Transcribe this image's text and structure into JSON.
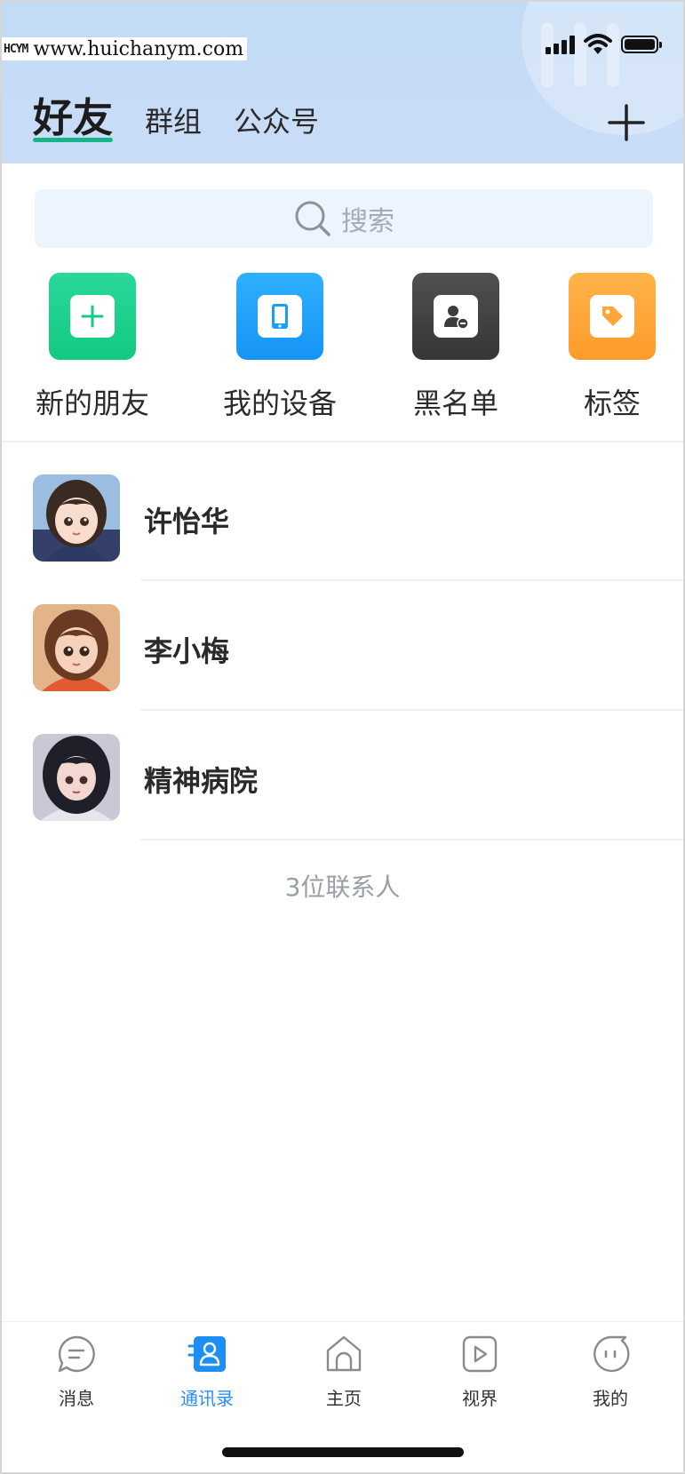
{
  "watermark": {
    "logo": "HCYM",
    "url": "www.huichanym.com"
  },
  "header": {
    "tabs": [
      {
        "label": "好友",
        "active": true
      },
      {
        "label": "群组",
        "active": false
      },
      {
        "label": "公众号",
        "active": false
      }
    ],
    "add_icon": "plus-icon"
  },
  "search": {
    "placeholder": "搜索",
    "icon": "search-icon"
  },
  "quick_actions": [
    {
      "label": "新的朋友",
      "icon": "add-friend-icon",
      "color": "#1ccf8b"
    },
    {
      "label": "我的设备",
      "icon": "phone-icon",
      "color": "#1a9ff8"
    },
    {
      "label": "黑名单",
      "icon": "blocked-user-icon",
      "color": "#414141"
    },
    {
      "label": "标签",
      "icon": "tag-icon",
      "color": "#fea637"
    }
  ],
  "contacts": [
    {
      "name": "许怡华"
    },
    {
      "name": "李小梅"
    },
    {
      "name": "精神病院"
    }
  ],
  "contact_count": "3位联系人",
  "tabbar": {
    "items": [
      {
        "label": "消息",
        "icon": "chat-bubble-icon",
        "active": false
      },
      {
        "label": "通讯录",
        "icon": "contacts-icon",
        "active": true
      },
      {
        "label": "主页",
        "icon": "home-icon",
        "active": false
      },
      {
        "label": "视界",
        "icon": "video-play-icon",
        "active": false
      },
      {
        "label": "我的",
        "icon": "profile-face-icon",
        "active": false
      }
    ]
  },
  "colors": {
    "accent": "#2a8cf6",
    "underline": "#19b38a",
    "header_bg": "#c3dbf6"
  }
}
